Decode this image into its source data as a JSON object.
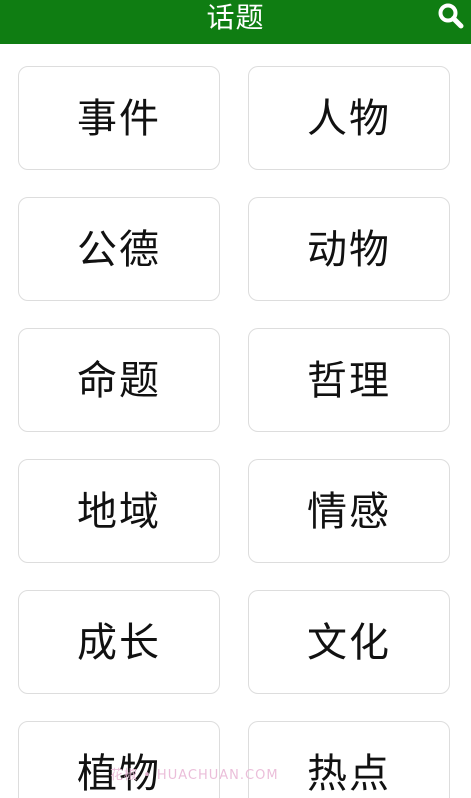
{
  "header": {
    "title": "话题",
    "search_icon": "search-icon",
    "bg_color": "#0f7d12"
  },
  "topics": [
    {
      "label": "事件"
    },
    {
      "label": "人物"
    },
    {
      "label": "公德"
    },
    {
      "label": "动物"
    },
    {
      "label": "命题"
    },
    {
      "label": "哲理"
    },
    {
      "label": "地域"
    },
    {
      "label": "情感"
    },
    {
      "label": "成长"
    },
    {
      "label": "文化"
    },
    {
      "label": "植物"
    },
    {
      "label": "热点"
    }
  ],
  "watermark": {
    "text": "花椒 • HUACHUAN.COM"
  }
}
